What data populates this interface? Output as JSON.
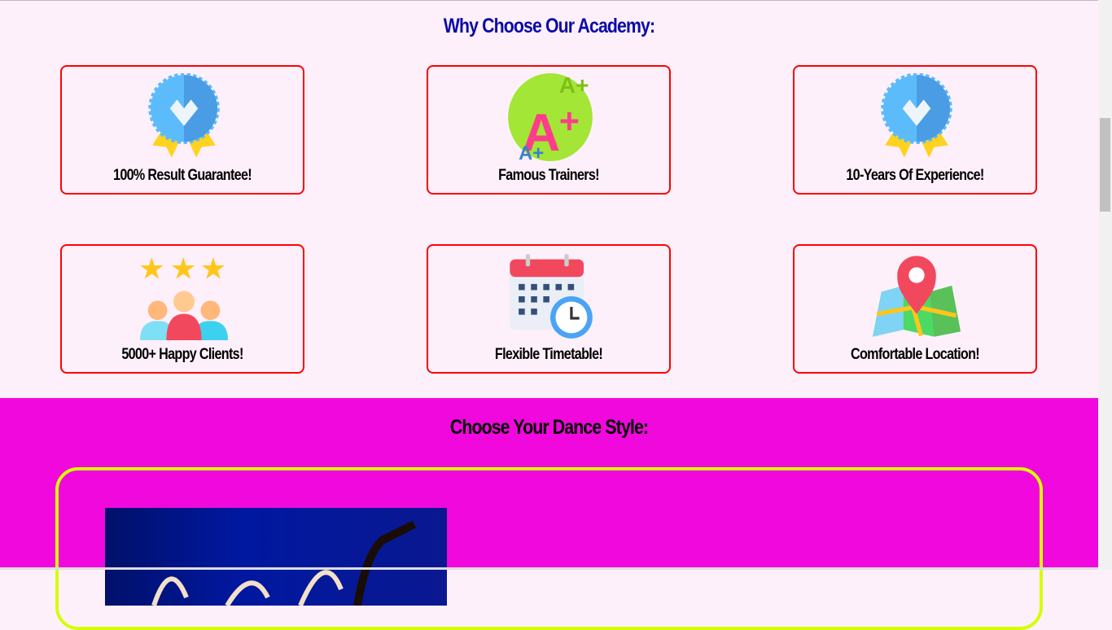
{
  "features": {
    "title": "Why Choose Our Academy:",
    "items": [
      {
        "label": "100% Result Guarantee!",
        "icon": "award-badge-icon"
      },
      {
        "label": "Famous Trainers!",
        "icon": "a-plus-grade-icon"
      },
      {
        "label": "10-Years Of Experience!",
        "icon": "award-badge-icon"
      },
      {
        "label": "5000+ Happy Clients!",
        "icon": "happy-clients-stars-icon"
      },
      {
        "label": "Flexible Timetable!",
        "icon": "calendar-clock-icon"
      },
      {
        "label": "Comfortable Location!",
        "icon": "map-pin-icon"
      }
    ]
  },
  "dance": {
    "title": "Choose Your Dance Style:"
  },
  "colors": {
    "page_bg": "#fdf0fb",
    "heading": "#0a0aa8",
    "card_border": "#ff0000",
    "section_bg": "#f008dc",
    "box_border": "#d4ff00"
  }
}
